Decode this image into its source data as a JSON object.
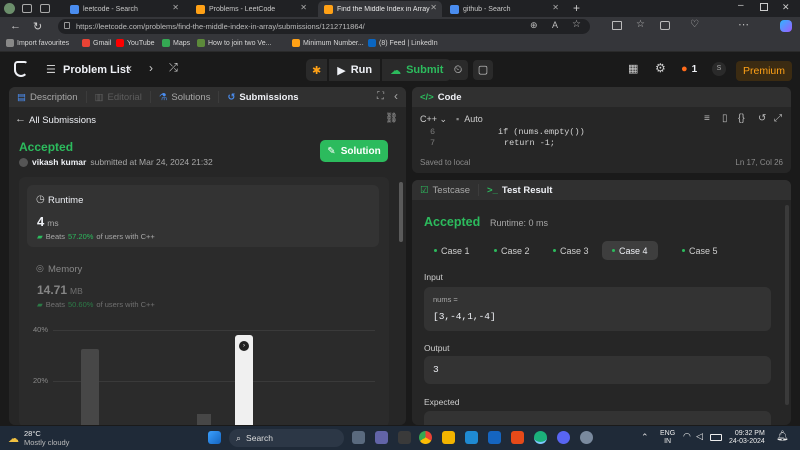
{
  "browser": {
    "tabs": [
      {
        "label": "leetcode - Search",
        "color": "#4a8df0"
      },
      {
        "label": "Problems - LeetCode",
        "color": "#ffa116"
      },
      {
        "label": "Find the Middle Index in Array - ...",
        "color": "#ffa116"
      },
      {
        "label": "github - Search",
        "color": "#4a8df0"
      }
    ],
    "url": "https://leetcode.com/problems/find-the-middle-index-in-array/submissions/1212711864/",
    "bookmarks": [
      {
        "label": "Import favourites",
        "color": "#888888"
      },
      {
        "label": "Gmail",
        "color": "#ea4335"
      },
      {
        "label": "YouTube",
        "color": "#ff0000"
      },
      {
        "label": "Maps",
        "color": "#34a853"
      },
      {
        "label": "How to join two Ve...",
        "color": "#5c8a3a"
      },
      {
        "label": "Minimum Number...",
        "color": "#ffa116"
      },
      {
        "label": "(8) Feed | LinkedIn",
        "color": "#0a66c2"
      }
    ]
  },
  "nav": {
    "problem_list": "Problem List",
    "run": "Run",
    "submit": "Submit",
    "streak": "1",
    "premium": "Premium",
    "avatar": "S"
  },
  "left": {
    "tabs": [
      "Description",
      "Editorial",
      "Solutions",
      "Submissions"
    ],
    "back": "All Submissions",
    "status": "Accepted",
    "user": "vikash kumar",
    "submitted": "submitted at Mar 24, 2024 21:32",
    "solution_btn": "Solution",
    "runtime": {
      "title": "Runtime",
      "value": "4",
      "unit": "ms",
      "beats": "Beats",
      "pct": "57.20%",
      "suffix": "of users with C++"
    },
    "memory": {
      "title": "Memory",
      "value": "14.71",
      "unit": "MB",
      "beats": "Beats",
      "pct": "50.60%",
      "suffix": "of users with C++"
    },
    "chart": {
      "y_labels": [
        "40%",
        "20%"
      ]
    }
  },
  "code": {
    "title": "Code",
    "lang": "C++",
    "auto": "Auto",
    "lines": [
      {
        "num": "6",
        "text": "if (nums.empty())"
      },
      {
        "num": "7",
        "text": "return -1;"
      }
    ],
    "saved": "Saved to local",
    "position": "Ln 17, Col 26"
  },
  "result": {
    "tab_testcase": "Testcase",
    "tab_result": "Test Result",
    "status": "Accepted",
    "runtime": "Runtime: 0 ms",
    "cases": [
      "Case 1",
      "Case 2",
      "Case 3",
      "Case 4",
      "Case 5"
    ],
    "input_label": "Input",
    "param": "nums =",
    "param_value": "[3,-4,1,-4]",
    "output_label": "Output",
    "output_value": "3",
    "expected_label": "Expected"
  },
  "taskbar": {
    "temp": "28°C",
    "weather": "Mostly cloudy",
    "search": "Search",
    "lang": "ENG",
    "region": "IN",
    "time": "09:32 PM",
    "date": "24-03-2024"
  }
}
